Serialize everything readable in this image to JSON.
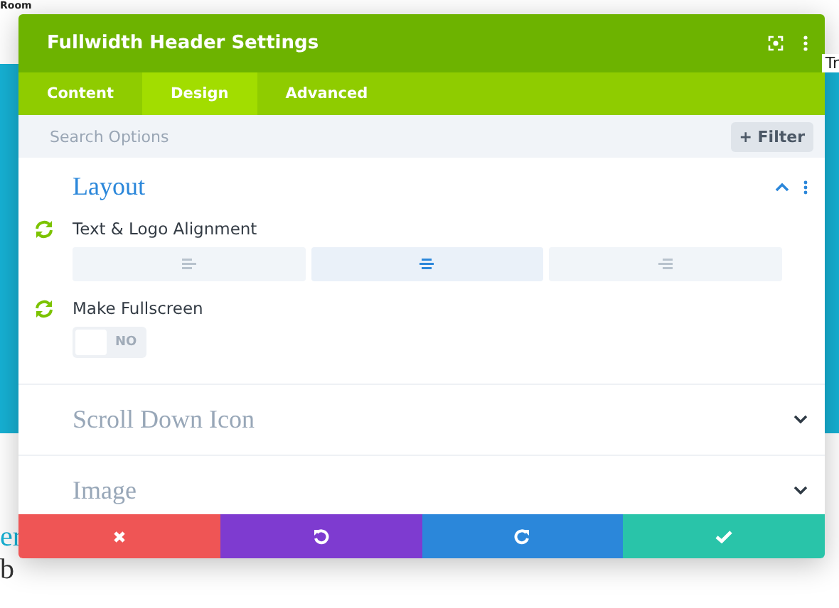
{
  "background_page": {
    "top_label": "Room",
    "right_label": "Tr",
    "link_fragment": "er",
    "body_fragment": "b"
  },
  "modal": {
    "title": "Fullwidth Header Settings",
    "tabs": [
      {
        "label": "Content",
        "selected": false
      },
      {
        "label": "Design",
        "selected": true
      },
      {
        "label": "Advanced",
        "selected": false
      }
    ],
    "search": {
      "placeholder": "Search Options"
    },
    "filter_button": "+ Filter",
    "sections": [
      {
        "title": "Layout",
        "expanded": true,
        "options": [
          {
            "kind": "alignment",
            "label": "Text & Logo Alignment",
            "choices": [
              {
                "selected": false
              },
              {
                "selected": true
              },
              {
                "selected": false
              }
            ]
          },
          {
            "kind": "toggle",
            "label": "Make Fullscreen",
            "on": false,
            "value_text": "NO"
          }
        ]
      },
      {
        "title": "Scroll Down Icon",
        "expanded": false
      },
      {
        "title": "Image",
        "expanded": false
      }
    ],
    "footer_buttons": [
      {
        "kind": "discard"
      },
      {
        "kind": "undo"
      },
      {
        "kind": "redo"
      },
      {
        "kind": "save"
      }
    ]
  }
}
